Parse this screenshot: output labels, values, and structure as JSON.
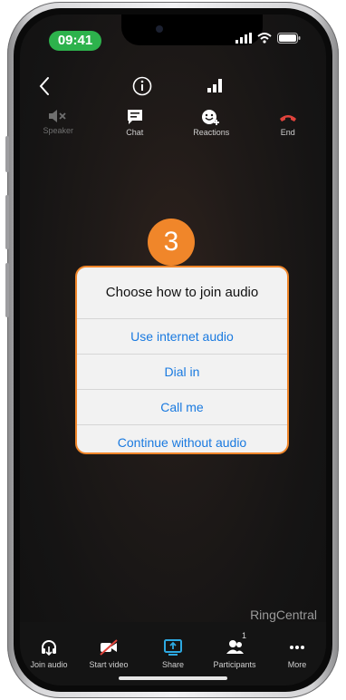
{
  "status_bar": {
    "time": "09:41"
  },
  "controls": {
    "speaker_label": "Speaker",
    "chat_label": "Chat",
    "reactions_label": "Reactions",
    "end_label": "End"
  },
  "overlay": {
    "step_number": "3"
  },
  "dialog": {
    "title": "Choose how to join audio",
    "options": [
      "Use internet audio",
      "Dial in",
      "Call me",
      "Continue without audio"
    ]
  },
  "brand": {
    "name": "RingCentral"
  },
  "bottom_bar": {
    "join_audio": "Join audio",
    "start_video": "Start video",
    "share": "Share",
    "participants": "Participants",
    "participants_count": "1",
    "more": "More"
  },
  "colors": {
    "accent_orange": "#f0862a",
    "link_blue": "#1a7ae0",
    "time_green": "#2db24c",
    "end_red": "#e0433c",
    "share_blue": "#2da8e0"
  },
  "icons": [
    "back-chevron-icon",
    "info-icon",
    "signal-strength-icon",
    "speaker-muted-icon",
    "chat-icon",
    "reactions-icon",
    "end-call-icon",
    "headphones-icon",
    "video-off-icon",
    "share-screen-icon",
    "participants-icon",
    "more-dots-icon"
  ]
}
